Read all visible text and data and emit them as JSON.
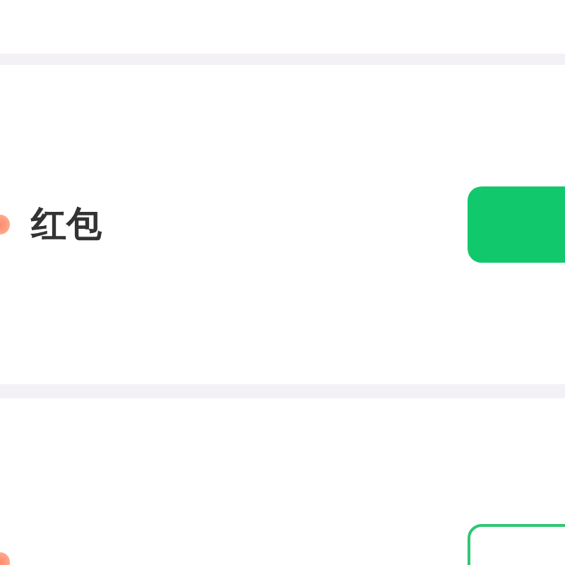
{
  "items": [
    {
      "title": "红包",
      "button": {
        "kind": "filled"
      }
    },
    {
      "button": {
        "kind": "outline"
      }
    }
  ]
}
